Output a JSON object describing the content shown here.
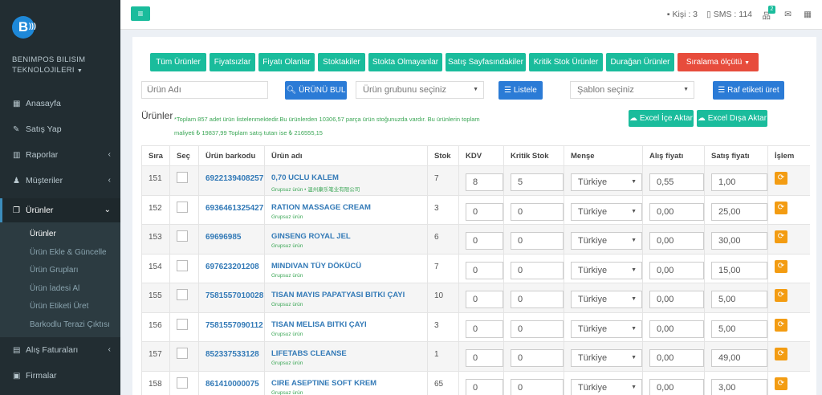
{
  "brand": {
    "logo_letter": "B",
    "company_name": "BENIMPOS BILISIM TEKNOLOJILERI",
    "accent": "#1abc9c"
  },
  "sidebar": {
    "items": [
      {
        "label": "Anasayfa",
        "icon": "th-large-icon"
      },
      {
        "label": "Satış Yap",
        "icon": "edit-icon"
      },
      {
        "label": "Raporlar",
        "icon": "bar-chart-icon"
      },
      {
        "label": "Müşteriler",
        "icon": "users-icon"
      },
      {
        "label": "Ürünler",
        "icon": "copy-icon"
      },
      {
        "label": "Alış Faturaları",
        "icon": "book-icon"
      },
      {
        "label": "Firmalar",
        "icon": "building-icon"
      }
    ],
    "submenu": [
      "Ürünler",
      "Ürün Ekle & Güncelle",
      "Ürün Grupları",
      "Ürün İadesi Al",
      "Ürün Etiketi Üret",
      "Barkodlu Terazi Çıktısı"
    ]
  },
  "topbar": {
    "kisi": "Kişi : 3",
    "sms": "SMS : 114",
    "notif_count": "2"
  },
  "filters": [
    "Tüm Ürünler",
    "Fiyatsızlar",
    "Fiyatı Olanlar",
    "Stoktakiler",
    "Stokta Olmayanlar",
    "Satış Sayfasındakiler",
    "Kritik Stok Ürünler",
    "Durağan Ürünler",
    "Sıralama ölçütü"
  ],
  "search": {
    "placeholder": "Ürün Adı",
    "find_button": "ÜRÜNÜ BUL",
    "group_select": "Ürün grubunu seçiniz",
    "list_button": "Listele",
    "template_select": "Şablon seçiniz",
    "shelf_button": "Raf etiketi üret"
  },
  "summary": {
    "title": "Ürünler",
    "text": "*Toplam 857 adet ürün listelenmektedir.Bu ürünlerden 10306,57 parça ürün stoğunuzda vardır. Bu ürünlerin toplam maliyeti ₺ 19837,99 Toplam satış tutarı ise ₺ 216555,15",
    "import_button": "Excel İçe Aktar",
    "export_button": "Excel Dışa Aktar"
  },
  "table": {
    "headers": [
      "Sıra",
      "Seç",
      "Ürün barkodu",
      "Ürün adı",
      "Stok",
      "KDV",
      "Kritik Stok",
      "Menşe",
      "Alış fiyatı",
      "Satış fiyatı",
      "İşlem"
    ],
    "rows": [
      {
        "sira": "151",
        "barcode": "6922139408257",
        "name": "0,70 UCLU KALEM",
        "group": "Grupsuz ürün • 温州康乐笔业有限公司",
        "stok": "7",
        "kdv": "8",
        "kritik": "5",
        "mense": "Türkiye",
        "alis": "0,55",
        "satis": "1,00"
      },
      {
        "sira": "152",
        "barcode": "6936461325427",
        "name": "RATION MASSAGE CREAM",
        "group": "Grupsuz ürün",
        "stok": "3",
        "kdv": "0",
        "kritik": "0",
        "mense": "Türkiye",
        "alis": "0,00",
        "satis": "25,00"
      },
      {
        "sira": "153",
        "barcode": "69696985",
        "name": "GINSENG ROYAL JEL",
        "group": "Grupsuz ürün",
        "stok": "6",
        "kdv": "0",
        "kritik": "0",
        "mense": "Türkiye",
        "alis": "0,00",
        "satis": "30,00"
      },
      {
        "sira": "154",
        "barcode": "697623201208",
        "name": "MINDIVAN TÜY DÖKÜCÜ",
        "group": "Grupsuz ürün",
        "stok": "7",
        "kdv": "0",
        "kritik": "0",
        "mense": "Türkiye",
        "alis": "0,00",
        "satis": "15,00"
      },
      {
        "sira": "155",
        "barcode": "7581557010028",
        "name": "TISAN MAYIS PAPATYASI BITKI ÇAYI",
        "group": "Grupsuz ürün",
        "stok": "10",
        "kdv": "0",
        "kritik": "0",
        "mense": "Türkiye",
        "alis": "0,00",
        "satis": "5,00"
      },
      {
        "sira": "156",
        "barcode": "7581557090112",
        "name": "TISAN MELISA BITKI ÇAYI",
        "group": "Grupsuz ürün",
        "stok": "3",
        "kdv": "0",
        "kritik": "0",
        "mense": "Türkiye",
        "alis": "0,00",
        "satis": "5,00"
      },
      {
        "sira": "157",
        "barcode": "852337533128",
        "name": "LIFETABS CLEANSE",
        "group": "Grupsuz ürün",
        "stok": "1",
        "kdv": "0",
        "kritik": "0",
        "mense": "Türkiye",
        "alis": "0,00",
        "satis": "49,00"
      },
      {
        "sira": "158",
        "barcode": "861410000075",
        "name": "CIRE ASEPTINE SOFT KREM",
        "group": "Grupsuz ürün",
        "stok": "65",
        "kdv": "0",
        "kritik": "0",
        "mense": "Türkiye",
        "alis": "0,00",
        "satis": "3,00"
      }
    ]
  }
}
